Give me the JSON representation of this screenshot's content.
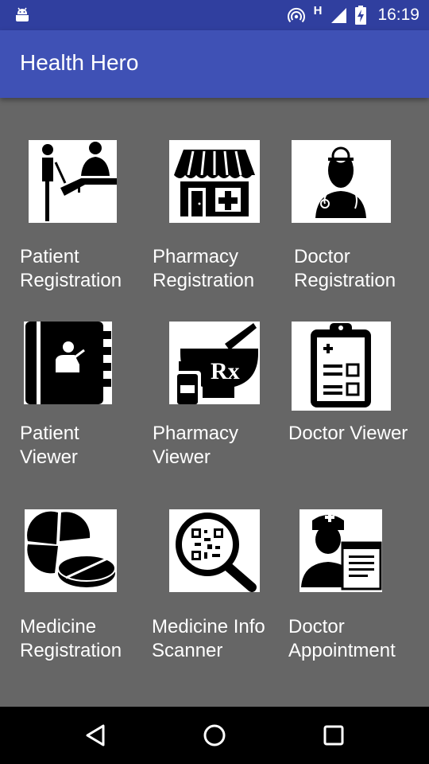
{
  "status_bar": {
    "time": "16:19",
    "network_type": "H",
    "icons": [
      "android-icon",
      "hotspot-icon",
      "signal-icon",
      "battery-charging-icon"
    ]
  },
  "app_bar": {
    "title": "Health Hero"
  },
  "tiles": [
    {
      "label": "Patient\nRegistration",
      "icon": "patient-registration-icon"
    },
    {
      "label": "Pharmacy\nRegistration",
      "icon": "pharmacy-store-icon"
    },
    {
      "label": "Doctor\nRegistration",
      "icon": "doctor-icon"
    },
    {
      "label": "Patient\nViewer",
      "icon": "patient-record-book-icon"
    },
    {
      "label": "Pharmacy\nViewer",
      "icon": "mortar-pestle-rx-icon"
    },
    {
      "label": "Doctor Viewer",
      "icon": "clipboard-checklist-icon"
    },
    {
      "label": "Medicine\nRegistration",
      "icon": "pills-icon"
    },
    {
      "label": "Medicine Info\nScanner",
      "icon": "qr-magnifier-icon"
    },
    {
      "label": "Doctor\nAppointment",
      "icon": "nurse-appointment-icon"
    }
  ],
  "nav_bar": {
    "buttons": [
      "back",
      "home",
      "recents"
    ]
  },
  "colors": {
    "status_bar": "#303f9f",
    "app_bar": "#3f51b5",
    "background": "#666666",
    "nav_bar": "#000000"
  }
}
